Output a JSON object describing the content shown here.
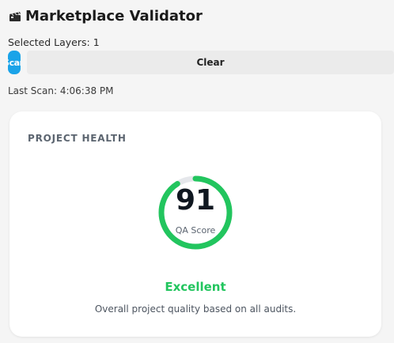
{
  "header": {
    "title": "Marketplace Validator",
    "icon": "clapperboard-icon"
  },
  "selection": {
    "selected_layers": "Selected Layers: 1"
  },
  "toolbar": {
    "scan_label": "Scan",
    "clear_label": "Clear"
  },
  "last_scan": "Last Scan: 4:06:38 PM",
  "health_card": {
    "heading": "PROJECT HEALTH",
    "score": "91",
    "score_label": "QA Score",
    "score_fraction": 0.91,
    "status": "Excellent",
    "description": "Overall project quality based on all audits."
  },
  "colors": {
    "accent_blue": "#1aa3e8",
    "success_green": "#22c55e",
    "track_gray": "#e5e7eb"
  }
}
